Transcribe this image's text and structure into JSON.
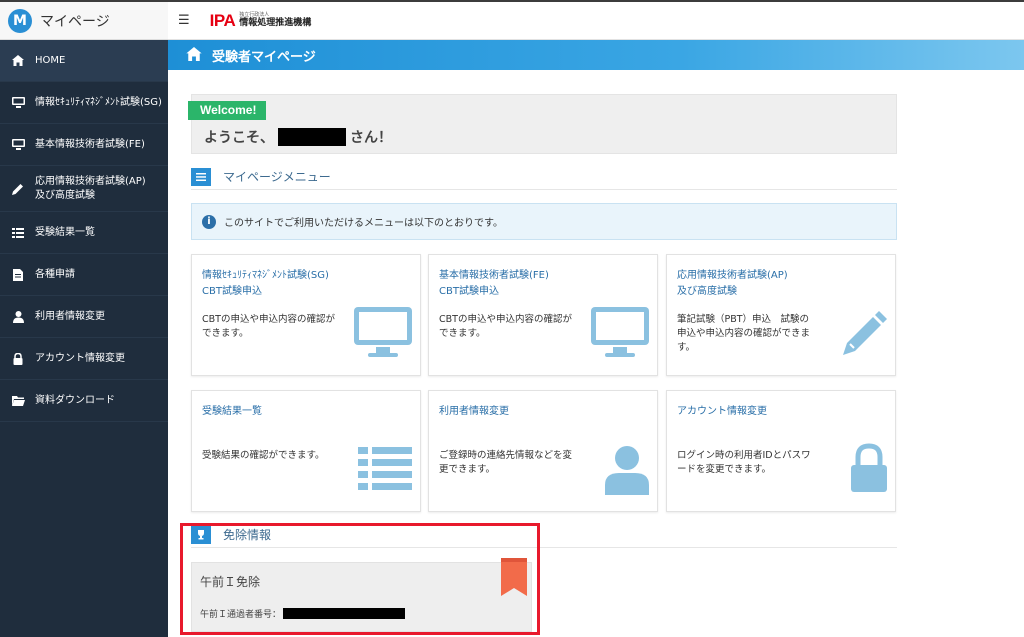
{
  "brand": {
    "logo_letter": "M",
    "name": "マイページ"
  },
  "header": {
    "menu_icon": "☰",
    "org_mark": "IPA",
    "org_small": "独立行政法人",
    "org_name": "情報処理推進機構"
  },
  "sidebar": {
    "items": [
      {
        "label": "HOME",
        "icon": "home-icon"
      },
      {
        "label": "情報ｾｷｭﾘﾃｨﾏﾈｼﾞﾒﾝﾄ試験(SG)",
        "icon": "monitor-icon"
      },
      {
        "label": "基本情報技術者試験(FE)",
        "icon": "monitor-icon"
      },
      {
        "label": "応用情報技術者試験(AP)\n及び高度試験",
        "icon": "pencil-icon"
      },
      {
        "label": "受験結果一覧",
        "icon": "list-icon"
      },
      {
        "label": "各種申請",
        "icon": "document-icon"
      },
      {
        "label": "利用者情報変更",
        "icon": "user-icon"
      },
      {
        "label": "アカウント情報変更",
        "icon": "lock-icon"
      },
      {
        "label": "資料ダウンロード",
        "icon": "folder-icon"
      }
    ]
  },
  "banner": {
    "title": "受験者マイページ"
  },
  "welcome": {
    "tag": "Welcome!",
    "greeting": "ようこそ、",
    "suffix": "さん！"
  },
  "menu_section": {
    "title": "マイページメニュー"
  },
  "info": {
    "icon": "i",
    "text": "このサイトでご利用いただけるメニューは以下のとおりです。"
  },
  "cards": [
    {
      "title": "情報ｾｷｭﾘﾃｨﾏﾈｼﾞﾒﾝﾄ試験(SG)\nCBT試験申込",
      "desc": "CBTの申込や申込内容の確認ができます。",
      "icon": "monitor-icon"
    },
    {
      "title": "基本情報技術者試験(FE)\nCBT試験申込",
      "desc": "CBTの申込や申込内容の確認ができます。",
      "icon": "monitor-icon"
    },
    {
      "title": "応用情報技術者試験(AP)\n及び高度試験",
      "desc": "筆記試験（PBT）申込　試験の申込や申込内容の確認ができます。",
      "icon": "pencil-icon"
    },
    {
      "title": "受験結果一覧",
      "desc": "受験結果の確認ができます。",
      "icon": "list-icon"
    },
    {
      "title": "利用者情報変更",
      "desc": "ご登録時の連絡先情報などを変更できます。",
      "icon": "user-icon"
    },
    {
      "title": "アカウント情報変更",
      "desc": "ログイン時の利用者IDとパスワードを変更できます。",
      "icon": "lock-icon"
    }
  ],
  "exemption_section": {
    "title": "免除情報"
  },
  "exemption": {
    "title": "午前Ｉ免除",
    "number_label": "午前Ｉ通過者番号："
  },
  "colors": {
    "accent": "#2a8fd4",
    "sidebar": "#1f2d3d",
    "welcome_tag": "#2bb56a",
    "highlight": "#e8192c",
    "ribbon": "#f26b4a"
  }
}
